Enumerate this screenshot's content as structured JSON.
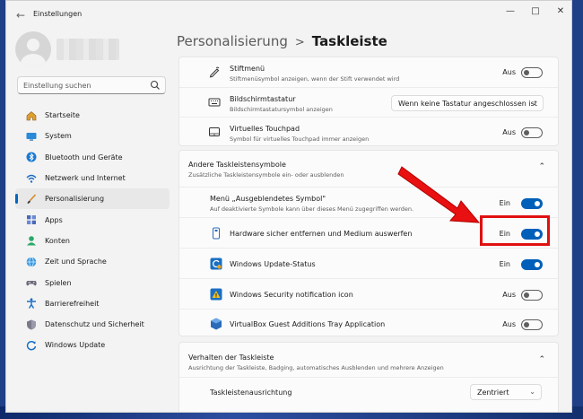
{
  "window": {
    "app_title": "Einstellungen",
    "back_glyph": "←",
    "min_glyph": "—",
    "max_glyph": "□",
    "close_glyph": "✕"
  },
  "sidebar": {
    "search_placeholder": "Einstellung suchen",
    "items": [
      {
        "label": "Startseite",
        "icon": "home-icon"
      },
      {
        "label": "System",
        "icon": "system-icon"
      },
      {
        "label": "Bluetooth und Geräte",
        "icon": "bluetooth-icon"
      },
      {
        "label": "Netzwerk und Internet",
        "icon": "network-icon"
      },
      {
        "label": "Personalisierung",
        "icon": "brush-icon",
        "active": true
      },
      {
        "label": "Apps",
        "icon": "apps-icon"
      },
      {
        "label": "Konten",
        "icon": "account-icon"
      },
      {
        "label": "Zeit und Sprache",
        "icon": "globe-clock-icon"
      },
      {
        "label": "Spielen",
        "icon": "gamepad-icon"
      },
      {
        "label": "Barrierefreiheit",
        "icon": "accessibility-icon"
      },
      {
        "label": "Datenschutz und Sicherheit",
        "icon": "shield-icon"
      },
      {
        "label": "Windows Update",
        "icon": "update-icon"
      }
    ]
  },
  "header": {
    "parent": "Personalisierung",
    "separator": ">",
    "current": "Taskleiste"
  },
  "pen_section": {
    "rows": [
      {
        "title": "Stiftmenü",
        "subtitle": "Stiftmenüsymbol anzeigen, wenn der Stift verwendet wird",
        "state": "Aus",
        "on": false
      },
      {
        "title": "Bildschirmtastatur",
        "subtitle": "Bildschirmtastatursymbol anzeigen",
        "dropdown": "Wenn keine Tastatur angeschlossen ist"
      },
      {
        "title": "Virtuelles Touchpad",
        "subtitle": "Symbol für virtuelles Touchpad immer anzeigen",
        "state": "Aus",
        "on": false
      }
    ]
  },
  "other_icons_section": {
    "title": "Andere Taskleistensymbole",
    "subtitle": "Zusätzliche Taskleistensymbole ein- oder ausblenden",
    "rows": [
      {
        "title": "Menü „Ausgeblendetes Symbol\"",
        "subtitle": "Auf deaktivierte Symbole kann über dieses Menü zugegriffen werden.",
        "state": "Ein",
        "on": true
      },
      {
        "title": "Hardware sicher entfernen und Medium auswerfen",
        "state": "Ein",
        "on": true
      },
      {
        "title": "Windows Update-Status",
        "state": "Ein",
        "on": true
      },
      {
        "title": "Windows Security notification icon",
        "state": "Aus",
        "on": false
      },
      {
        "title": "VirtualBox Guest Additions Tray Application",
        "state": "Aus",
        "on": false
      }
    ]
  },
  "behavior_section": {
    "title": "Verhalten der Taskleiste",
    "subtitle": "Ausrichtung der Taskleiste, Badging, automatisches Ausblenden und mehrere Anzeigen",
    "alignment_label": "Taskleistenausrichtung",
    "alignment_value": "Zentriert"
  },
  "colors": {
    "accent": "#005fb8",
    "highlight": "#e01010"
  }
}
